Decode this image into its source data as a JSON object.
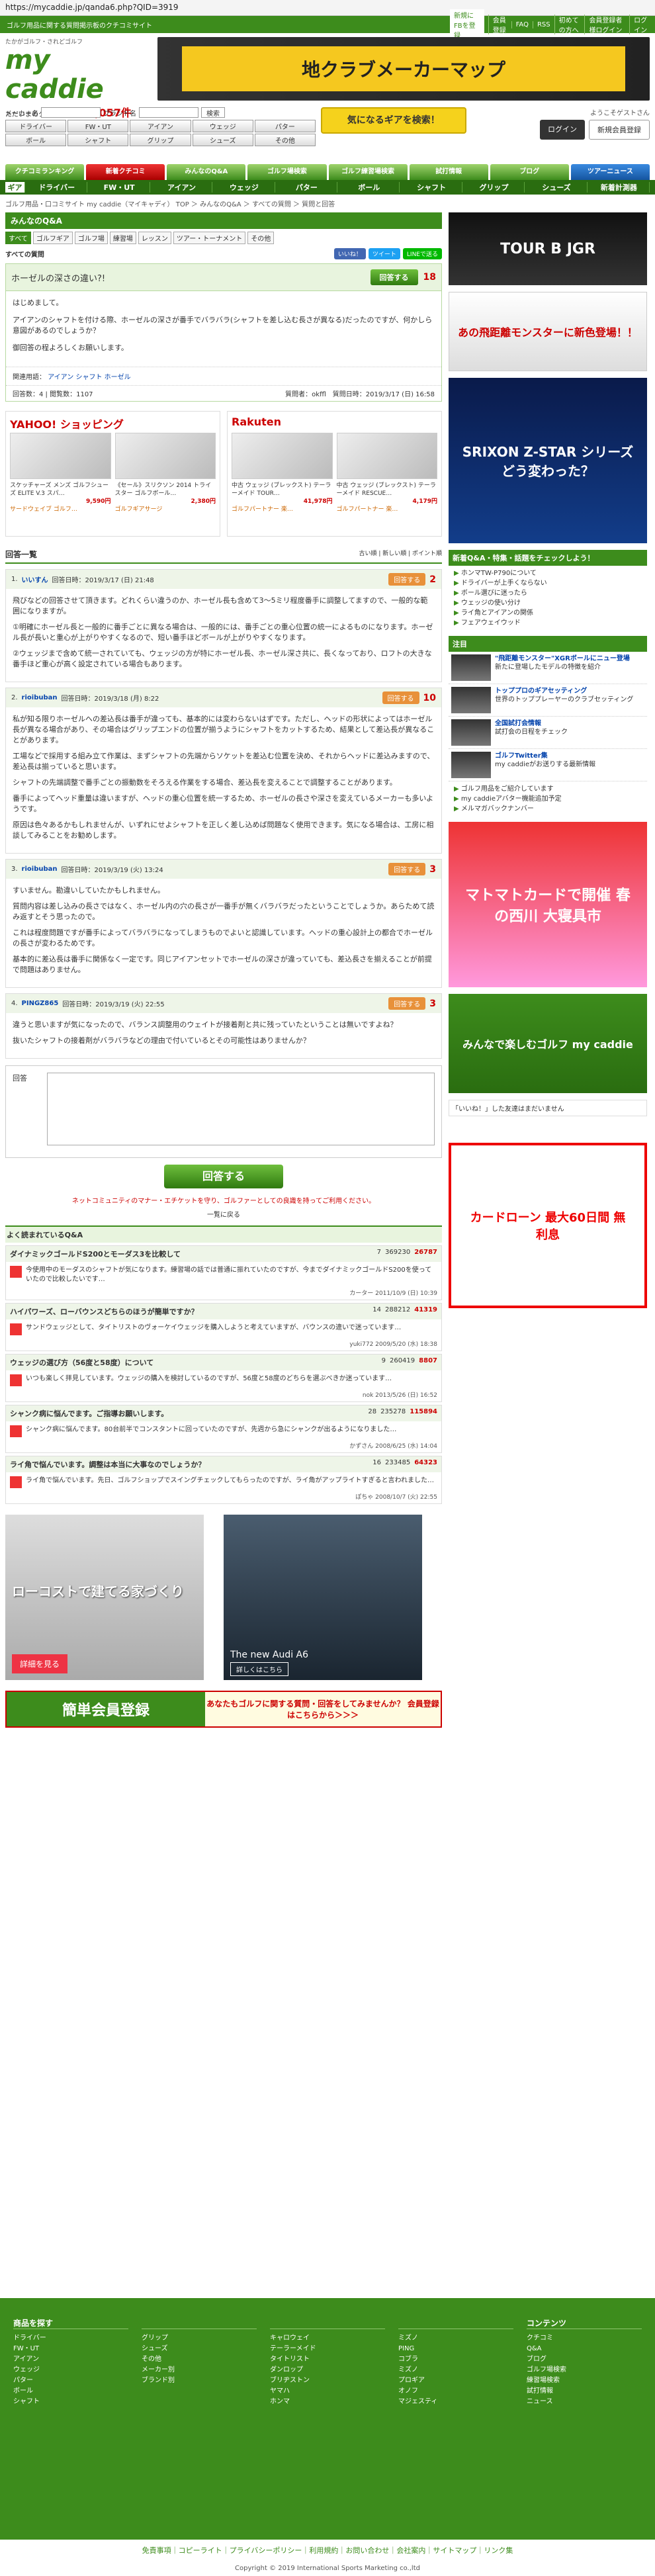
{
  "url": "https://mycaddie.jp/qanda6.php?QID=3919",
  "top": {
    "tagline": "ゴルフ用品に関する質問掲示板のクチコミサイト",
    "links": [
      "新規にFBを登録",
      "会員登録",
      "FAQ",
      "RSS",
      "初めての方へ",
      "会員登録者様ログイン",
      "ログイン"
    ]
  },
  "header": {
    "logo_tag": "たかがゴルフ・されどゴルフ",
    "logo_name": "my caddie",
    "count_label": "ただいまのクチコミ件数",
    "count_value": "33,057件",
    "banner": "地クラブメーカーマップ"
  },
  "search": {
    "maker_label": "メーカー名",
    "maker_value": "",
    "brand_label": "ブランド名",
    "brand_value": "",
    "search_btn": "検索",
    "categories": [
      "ドライバー",
      "FW・UT",
      "アイアン",
      "ウェッジ",
      "パター",
      "ボール",
      "シャフト",
      "グリップ",
      "シューズ",
      "その他"
    ],
    "big_button": "気になるギアを検索！",
    "welcome": "ようこそゲストさん",
    "login": "ログイン",
    "register": "新規会員登録"
  },
  "nav1": [
    "クチコミランキング",
    "新着クチコミ",
    "みんなのQ&A",
    "ゴルフ場検索",
    "ゴルフ練習場検索",
    "試打情報",
    "ブログ",
    "ツアーニュース"
  ],
  "nav2": [
    "ギア",
    "ドライバー",
    "FW・UT",
    "アイアン",
    "ウェッジ",
    "パター",
    "ボール",
    "シャフト",
    "グリップ",
    "シューズ",
    "新着計測器"
  ],
  "breadcrumb": "ゴルフ用品・口コミサイト my caddie（マイキャディ） TOP ＞ みんなのQ&A ＞ すべての質問 ＞ 質問と回答",
  "section_title": "みんなのQ&A",
  "tabs": [
    "すべて",
    "ゴルフギア",
    "ゴルフ場",
    "練習場",
    "レッスン",
    "ツアー・トーナメント",
    "その他"
  ],
  "all_questions": "すべての質問",
  "share": {
    "fb": "いいね！",
    "tw": "ツイート",
    "line": "LINEで送る"
  },
  "question": {
    "title": "ホーゼルの深さの違い?!",
    "answer_btn": "回答する",
    "points": "18",
    "body": [
      "はじめまして。",
      "アイアンのシャフトを付ける際、ホーゼルの深さが番手でバラバラ(シャフトを差し込む長さが異なる)だったのですが、何かしら意図があるのでしょうか？",
      "御回答の程よろしくお願いします。"
    ],
    "related_label": "関連用語：",
    "related": [
      "アイアン",
      "シャフト",
      "ホーゼル"
    ],
    "meta": "回答数：4 | 閲覧数：1107",
    "asker": "質問者：okffl　質問日時：2019/3/17 (日) 16:58"
  },
  "shops": {
    "yahoo": "YAHOO! ショッピング",
    "rakuten": "Rakuten",
    "yahoo_items": [
      {
        "name": "スケッチャーズ メンズ ゴルフシューズ ELITE V.3 スパ…",
        "price": "9,590円",
        "shop": "サードウェイブ ゴルフ…"
      },
      {
        "name": "《セール》スリクソン 2014 トライスター ゴルフボール…",
        "price": "2,380円",
        "shop": "ゴルフギアサージ"
      }
    ],
    "rakuten_items": [
      {
        "name": "中古 ウェッジ (ブレックスト) テーラーメイド TOUR…",
        "price": "41,978円",
        "shop": "ゴルフパートナー 楽…"
      },
      {
        "name": "中古 ウェッジ (ブレックスト) テーラーメイド RESCUE…",
        "price": "4,179円",
        "shop": "ゴルフパートナー 楽…"
      }
    ]
  },
  "answers_header": {
    "title": "回答一覧",
    "sort": "古い順 | 新しい順 | ポイント順"
  },
  "answers": [
    {
      "num": "1.",
      "user": "いいすん",
      "date": "回答日時：2019/3/17 (日) 21:48",
      "pts": "2",
      "body": [
        "飛びなどの回答させて頂きます。どれくらい違うのか、ホーゼル長も含めて3～5ミリ程度番手に調整してますので、一般的な範囲になりますが。",
        "①明確にホーゼル長と一般的に番手ごとに異なる場合は、一般的には、番手ごとの重心位置の統一によるものになります。ホーゼル長が長いと重心が上がりやすくなるので、短い番手ほどボールが上がりやすくなります。",
        "②ウェッジまで含めて統一されていても、ウェッジの方が特にホーゼル長、ホーゼル深さ共に、長くなっており、ロフトの大きな番手ほど重心が高く設定されている場合もあります。"
      ]
    },
    {
      "num": "2.",
      "user": "rioibuban",
      "date": "回答日時：2019/3/18 (月) 8:22",
      "pts": "10",
      "body": [
        "私が知る限りホーゼルへの差込長は番手が違っても、基本的には変わらないはずです。ただし、ヘッドの形状によってはホーゼル長が異なる場合があり、その場合はグリップエンドの位置が揃うようにシャフトをカットするため、結果として差込長が異なることがあります。",
        "工場などで採用する組み立て作業は、まずシャフトの先端からソケットを差込む位置を決め、それからヘッドに差込みますので、差込長は揃っていると思います。",
        "シャフトの先端調整で番手ごとの振動数をそろえる作業をする場合、差込長を変えることで調整することがあります。",
        "番手によってヘッド重量は違いますが、ヘッドの重心位置を統一するため、ホーゼルの長さや深さを変えているメーカーも多いようです。",
        "原因は色々あるかもしれませんが、いずれにせよシャフトを正しく差し込めば問題なく使用できます。気になる場合は、工房に相談してみることをお勧めします。"
      ]
    },
    {
      "num": "3.",
      "user": "rioibuban",
      "date": "回答日時：2019/3/19 (火) 13:24",
      "pts": "3",
      "body": [
        "すいません。勘違いしていたかもしれません。",
        "質問内容は差し込みの長さではなく、ホーゼル内の穴の長さが一番手が無くバラバラだったということでしょうか。あらためて読み返すとそう思ったので。",
        "これは程度問題ですが番手によってバラバラになってしまうものでよいと認識しています。ヘッドの重心設計上の都合でホーゼルの長さが変わるためです。",
        "基本的に差込長は番手に関係なく一定です。同じアイアンセットでホーゼルの深さが違っていても、差込長さを揃えることが前提で問題はありません。"
      ]
    },
    {
      "num": "4.",
      "user": "PINGZ865",
      "date": "回答日時：2019/3/19 (火) 22:55",
      "pts": "3",
      "body": [
        "違うと思いますが気になったので、バランス調整用のウェイトが接着剤と共に残っていたということは無いですよね？",
        "抜いたシャフトの接着剤がバラバラなどの理由で付いているとその可能性はありませんか？"
      ]
    }
  ],
  "reply": {
    "label": "回答",
    "submit": "回答する",
    "note": "ネットコミュニティのマナー・エチケットを守り、ゴルファーとしての良識を持ってご利用ください。",
    "back": "一覧に戻る"
  },
  "seen": {
    "title": "よく読まれているQ&A",
    "items": [
      {
        "title": "ダイナミックゴールドS200とモーダス3を比較して",
        "c": "7",
        "v": "369230",
        "p": "26787",
        "body": "今使用中のモーダスのシャフトが気になります。練習場の話では普通に振れていたのですが、今までダイナミックゴールドS200を使っていたので比較したいです…",
        "foot": "カーター 2011/10/9 (日) 10:39"
      },
      {
        "title": "ハイパワーズ、ローバウンスどちらのほうが簡単ですか？",
        "c": "14",
        "v": "288212",
        "p": "41319",
        "body": "サンドウェッジとして、タイトリストのヴォーケイウェッジを購入しようと考えていますが、バウンスの違いで迷っています…",
        "foot": "yuki772 2009/5/20 (水) 18:38"
      },
      {
        "title": "ウェッジの選び方（56度と58度）について",
        "c": "9",
        "v": "260419",
        "p": "8807",
        "body": "いつも楽しく拝見しています。ウェッジの購入を検討しているのですが、56度と58度のどちらを選ぶべきか迷っています…",
        "foot": "nok 2013/5/26 (日) 16:52"
      },
      {
        "title": "シャンク病に悩んでます。ご指導お願いします。",
        "c": "28",
        "v": "235278",
        "p": "115894",
        "body": "シャンク病に悩んでます。80台前半でコンスタントに回っていたのですが、先週から急にシャンクが出るようになりました…",
        "foot": "かずさん 2008/6/25 (水) 14:04"
      },
      {
        "title": "ライ角で悩んでいます。調整は本当に大事なのでしょうか？",
        "c": "16",
        "v": "233485",
        "p": "64323",
        "body": "ライ角で悩んでいます。先日、ゴルフショップでスイングチェックしてもらったのですが、ライ角がアップライトすぎると言われました…",
        "foot": "ぽちゃ 2008/10/7 (火) 22:55"
      }
    ]
  },
  "bottom_ads": {
    "ad1": "ローコストで建てる家づくり",
    "ad1_btn": "詳細を見る",
    "ad2": "The new Audi A6",
    "ad2_btn": "詳しくはこちら"
  },
  "reg_banner": {
    "left": "簡単会員登録",
    "right": "あなたもゴルフに関する質問・回答をしてみませんか？ 会員登録はこちらから＞＞＞"
  },
  "sidebar": {
    "ad1": "TOUR B JGR",
    "ad2": "あの飛距離モンスターに新色登場！！",
    "ad3": "SRIXON Z-STAR シリーズ どう変わった？",
    "news_title": "新着Q&A・特集・話題をチェックしよう！",
    "news": [
      "ホンマTW-P790について",
      "ドライバーが上手くならない",
      "ボール選びに迷ったら",
      "ウェッジの使い分け",
      "ライ角とアイアンの関係",
      "フェアウェイウッド"
    ],
    "notices_title": "注目",
    "notices": [
      {
        "t": "\"飛距離モンスター\"XGRボールにニュー登場",
        "d": "新たに登場したモデルの特徴を紹介"
      },
      {
        "t": "トッププロのギアセッティング",
        "d": "世界のトッププレーヤーのクラブセッティング"
      },
      {
        "t": "全国試打会情報",
        "d": "試打会の日程をチェック"
      },
      {
        "t": "ゴルフTwitter集",
        "d": "my caddieがお送りする最新情報"
      }
    ],
    "links": [
      "ゴルフ用品をご紹介しています",
      "my caddieアバター機能追加予定",
      "メルマガバックナンバー"
    ],
    "ad4": "マトマトカードで開催 春の西川 大寝具市",
    "ad5": "みんなで楽しむゴルフ my caddie",
    "like": "「いいね！」した友達はまだいません",
    "ad6": "カードローン 最大60日間 無利息"
  },
  "footer": {
    "col1_title": "商品を探す",
    "col1": [
      "ドライバー",
      "FW・UT",
      "アイアン",
      "ウェッジ",
      "パター",
      "ボール",
      "シャフト"
    ],
    "col2": [
      "グリップ",
      "シューズ",
      "その他",
      "メーカー別",
      "ブランド別"
    ],
    "col3": [
      "キャロウェイ",
      "テーラーメイド",
      "タイトリスト",
      "ダンロップ",
      "ブリヂストン",
      "ヤマハ",
      "ホンマ"
    ],
    "col4": [
      "ミズノ",
      "PING",
      "コブラ",
      "ミズノ",
      "プロギア",
      "オノフ",
      "マジェスティ"
    ],
    "col5_title": "コンテンツ",
    "col5": [
      "クチコミ",
      "Q&A",
      "ブログ",
      "ゴルフ場検索",
      "練習場検索",
      "試打情報",
      "ニュース"
    ],
    "links": "免責事項｜コピーライト｜プライバシーポリシー｜利用規約｜お問い合わせ｜会社案内｜サイトマップ｜リンク集",
    "copy": "Copyright © 2019 International Sports Marketing co.,ltd"
  }
}
